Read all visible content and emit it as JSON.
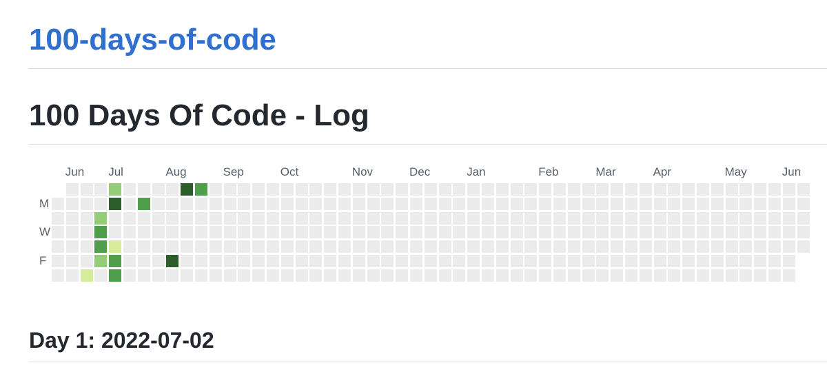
{
  "repo": {
    "title": "100-days-of-code"
  },
  "log": {
    "title": "100 Days Of Code - Log"
  },
  "heatmap": {
    "months": [
      "Jun",
      "Jul",
      "Aug",
      "Sep",
      "Oct",
      "Nov",
      "Dec",
      "Jan",
      "Feb",
      "Mar",
      "Apr",
      "May",
      "Jun"
    ],
    "month_week_index": [
      1,
      4,
      8,
      12,
      16,
      21,
      25,
      29,
      34,
      38,
      42,
      47,
      51
    ],
    "day_labels": [
      {
        "label": "M",
        "row": 1
      },
      {
        "label": "W",
        "row": 3
      },
      {
        "label": "F",
        "row": 5
      }
    ],
    "week_count": 53,
    "first_week_start_row": 1,
    "last_week_end_row": 4,
    "levels": [
      "#ebebeb",
      "#d6ec9a",
      "#94cc78",
      "#4f9e4b",
      "#2c5e2a"
    ],
    "active_days": [
      {
        "week": 4,
        "row": 0,
        "level": 2
      },
      {
        "week": 4,
        "row": 1,
        "level": 4
      },
      {
        "week": 3,
        "row": 2,
        "level": 2
      },
      {
        "week": 3,
        "row": 3,
        "level": 3
      },
      {
        "week": 3,
        "row": 4,
        "level": 3
      },
      {
        "week": 4,
        "row": 4,
        "level": 1
      },
      {
        "week": 3,
        "row": 5,
        "level": 2
      },
      {
        "week": 4,
        "row": 5,
        "level": 3
      },
      {
        "week": 2,
        "row": 6,
        "level": 1
      },
      {
        "week": 4,
        "row": 6,
        "level": 3
      },
      {
        "week": 6,
        "row": 1,
        "level": 3
      },
      {
        "week": 8,
        "row": 5,
        "level": 4
      },
      {
        "week": 9,
        "row": 0,
        "level": 4
      },
      {
        "week": 10,
        "row": 0,
        "level": 3
      }
    ]
  },
  "entry": {
    "heading": "Day 1: 2022-07-02"
  }
}
